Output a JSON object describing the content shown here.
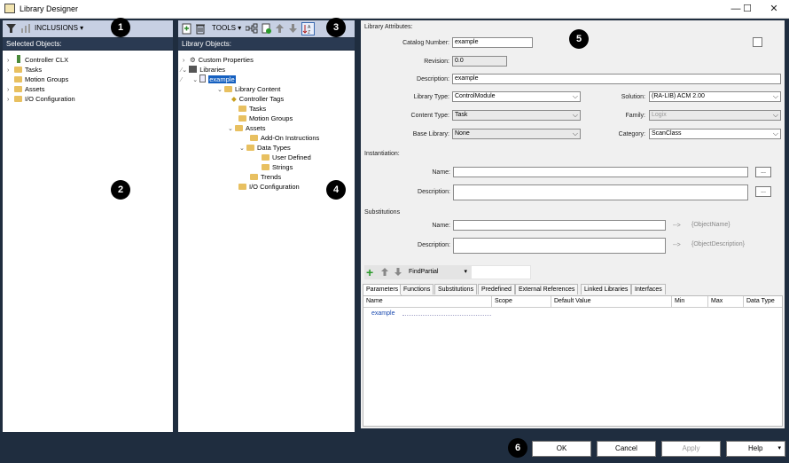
{
  "window": {
    "title": "Library Designer",
    "controls": [
      "—",
      "☐",
      "✕"
    ]
  },
  "left_panel": {
    "inclusions_label": "INCLUSIONS",
    "header": "Selected Objects:",
    "items": [
      "Controller CLX",
      "Tasks",
      "Motion Groups",
      "Assets",
      "I/O Configuration"
    ]
  },
  "middle_panel": {
    "tools_label": "TOOLS",
    "header": "Library Objects:",
    "tree": [
      "Custom Properties",
      "Libraries",
      "example",
      "Library Content",
      "Controller Tags",
      "Tasks",
      "Motion Groups",
      "Assets",
      "Add-On Instructions",
      "Data Types",
      "User Defined",
      "Strings",
      "Trends",
      "I/O Configuration"
    ]
  },
  "attributes": {
    "section_title": "Library Attributes:",
    "catalog_number_label": "Catalog Number:",
    "catalog_number": "example",
    "revision_label": "Revision:",
    "revision": "0.0",
    "description_label": "Description:",
    "description": "example",
    "library_type_label": "Library Type:",
    "library_type": "ControlModule",
    "solution_label": "Solution:",
    "solution": "(RA-LIB) ACM 2.00",
    "content_type_label": "Content Type:",
    "content_type": "Task",
    "family_label": "Family:",
    "family": "Logix",
    "base_library_label": "Base Library:",
    "base_library": "None",
    "category_label": "Category:",
    "category": "ScanClass"
  },
  "instantiation": {
    "title": "Instantiation:",
    "name_label": "Name:",
    "name": "",
    "description_label": "Description:",
    "description": "",
    "ellipsis": "..."
  },
  "substitutions": {
    "title": "Substitutions",
    "name_label": "Name:",
    "name": "",
    "name_arrow": "-->",
    "name_token": "{ObjectName}",
    "description_label": "Description:",
    "description": "",
    "description_arrow": "-->",
    "description_token": "{ObjectDescription}"
  },
  "grid_toolbar": {
    "find_mode": "FindPartial",
    "find_value": ""
  },
  "tabs": [
    "Parameters",
    "Functions",
    "Substitutions",
    "Predefined",
    "External References",
    "Linked Libraries",
    "Interfaces"
  ],
  "grid": {
    "columns": [
      "Name",
      "Scope",
      "Default Value",
      "Min",
      "Max",
      "Data Type"
    ],
    "rows": [
      [
        "example",
        "",
        "",
        "",
        "",
        ""
      ]
    ]
  },
  "buttons": {
    "ok": "OK",
    "cancel": "Cancel",
    "apply": "Apply",
    "help": "Help"
  },
  "badges": [
    "1",
    "2",
    "3",
    "4",
    "5",
    "6"
  ]
}
